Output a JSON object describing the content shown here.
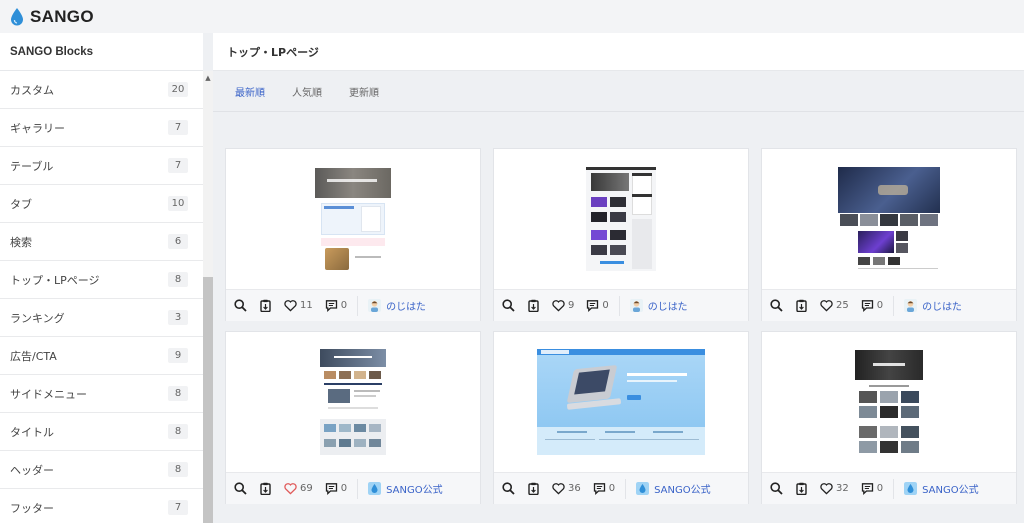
{
  "app": {
    "logo_text": "SANGO"
  },
  "sidebar": {
    "title": "SANGO Blocks",
    "items": [
      {
        "label": "カスタム",
        "count": "20"
      },
      {
        "label": "ギャラリー",
        "count": "7"
      },
      {
        "label": "テーブル",
        "count": "7"
      },
      {
        "label": "タブ",
        "count": "10"
      },
      {
        "label": "検索",
        "count": "6"
      },
      {
        "label": "トップ・LPページ",
        "count": "8"
      },
      {
        "label": "ランキング",
        "count": "3"
      },
      {
        "label": "広告/CTA",
        "count": "9"
      },
      {
        "label": "サイドメニュー",
        "count": "8"
      },
      {
        "label": "タイトル",
        "count": "8"
      },
      {
        "label": "ヘッダー",
        "count": "8"
      },
      {
        "label": "フッター",
        "count": "7"
      }
    ]
  },
  "main": {
    "title": "トップ・LPページ",
    "tabs": [
      {
        "label": "最新順",
        "active": true
      },
      {
        "label": "人気順",
        "active": false
      },
      {
        "label": "更新順",
        "active": false
      }
    ],
    "cards": [
      {
        "likes": "11",
        "comments": "0",
        "author": "のじはた",
        "liked": false
      },
      {
        "likes": "9",
        "comments": "0",
        "author": "のじはた",
        "liked": false
      },
      {
        "likes": "25",
        "comments": "0",
        "author": "のじはた",
        "liked": false
      },
      {
        "likes": "69",
        "comments": "0",
        "author": "SANGO公式",
        "liked": true
      },
      {
        "likes": "36",
        "comments": "0",
        "author": "SANGO公式",
        "liked": false
      },
      {
        "likes": "32",
        "comments": "0",
        "author": "SANGO公式",
        "liked": false
      }
    ]
  },
  "colors": {
    "accent": "#3a63c8",
    "liked_heart": "#e05a5a",
    "logo_blue": "#2f8fd8"
  }
}
